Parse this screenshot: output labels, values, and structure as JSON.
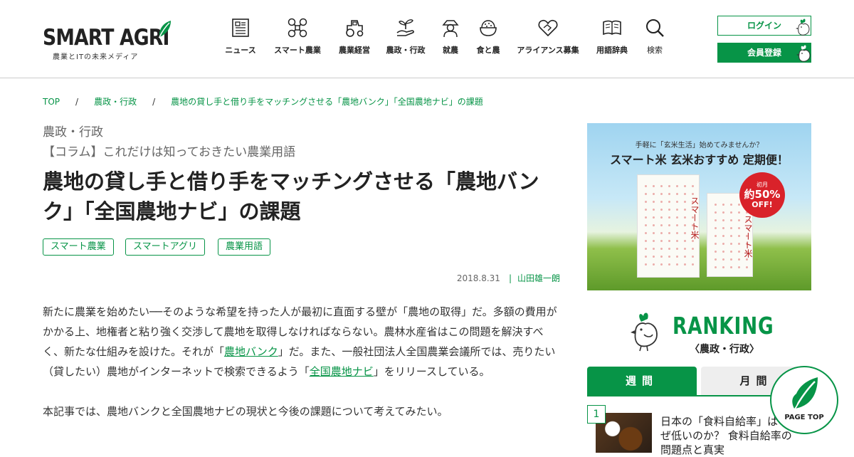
{
  "header": {
    "logo_text": "SMART AGRI",
    "logo_tagline": "農業とITの未来メディア",
    "nav": [
      {
        "label": "ニュース",
        "icon": "newspaper-icon"
      },
      {
        "label": "スマート農業",
        "icon": "drone-icon"
      },
      {
        "label": "農業経営",
        "icon": "tractor-icon"
      },
      {
        "label": "農政・行政",
        "icon": "sprout-hand-icon"
      },
      {
        "label": "就農",
        "icon": "farmer-icon"
      },
      {
        "label": "食と農",
        "icon": "rice-bowl-icon"
      },
      {
        "label": "アライアンス募集",
        "icon": "handshake-icon"
      },
      {
        "label": "用語辞典",
        "icon": "book-icon"
      },
      {
        "label": "検索",
        "icon": "search-icon"
      }
    ],
    "login_label": "ログイン",
    "register_label": "会員登録",
    "accent_color": "#079447"
  },
  "breadcrumb": {
    "items": [
      "TOP",
      "農政・行政",
      "農地の貸し手と借り手をマッチングさせる「農地バンク」「全国農地ナビ」の課題"
    ],
    "separator": "/"
  },
  "article": {
    "category": "農政・行政",
    "series": "【コラム】これだけは知っておきたい農業用語",
    "title": "農地の貸し手と借り手をマッチングさせる「農地バンク」「全国農地ナビ」の課題",
    "tags": [
      "スマート農業",
      "スマートアグリ",
      "農業用語"
    ],
    "date": "2018.8.31",
    "meta_separator": "|",
    "author": "山田雄一朗",
    "para1_a": "新たに農業を始めたい──そのような希望を持った人が最初に直面する壁が「農地の取得」だ。多額の費用がかかる上、地権者と粘り強く交渉して農地を取得しなければならない。農林水産省はこの問題を解決すべく、新たな仕組みを設けた。それが「",
    "link1": "農地バンク",
    "para1_b": "」だ。また、一般社団法人全国農業会議所では、売りたい（貸したい）農地がインターネットで検索できるよう「",
    "link2": "全国農地ナビ",
    "para1_c": "」をリリースしている。",
    "para2": "本記事では、農地バンクと全国農地ナビの現状と今後の課題について考えてみたい。"
  },
  "ad": {
    "top_text": "手軽に「玄米生活」始めてみませんか？",
    "main_text": "スマート米 玄米おすすめ 定期便！",
    "bag_label": "スマート米",
    "badge_line1": "初月",
    "badge_line2": "約50%",
    "badge_line3": "OFF!",
    "badge_color": "#d9222a"
  },
  "ranking": {
    "title": "RANKING",
    "subtitle": "〈農政・行政〉",
    "tabs": [
      "週間",
      "月間"
    ],
    "items": [
      {
        "rank": "1",
        "text": "日本の「食料自給率」はなぜ低いのか？ 食料自給率の問題点と真実"
      }
    ]
  },
  "pagetop": {
    "label": "PAGE TOP"
  }
}
